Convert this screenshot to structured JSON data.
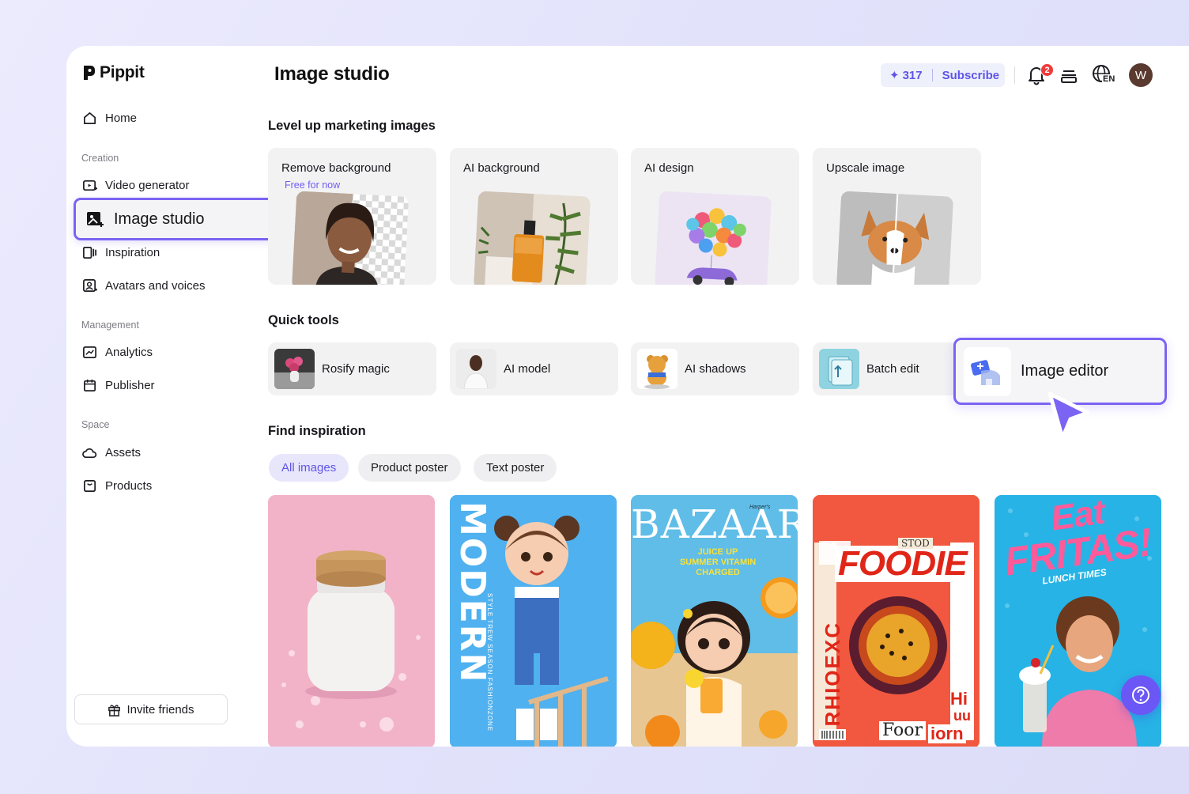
{
  "app": {
    "name": "Pippit"
  },
  "sidebar": {
    "home": "Home",
    "creation_label": "Creation",
    "items_creation": [
      "Video generator",
      "Image studio",
      "Inspiration",
      "Avatars and voices"
    ],
    "management_label": "Management",
    "items_management": [
      "Analytics",
      "Publisher"
    ],
    "space_label": "Space",
    "items_space": [
      "Assets",
      "Products"
    ],
    "invite": "Invite friends"
  },
  "header": {
    "title": "Image studio",
    "credits": "317",
    "subscribe": "Subscribe",
    "notification_count": "2",
    "language": "EN",
    "avatar_initial": "W"
  },
  "marketing": {
    "title": "Level up marketing images",
    "cards": [
      {
        "label": "Remove background",
        "sub": "Free for now"
      },
      {
        "label": "AI background"
      },
      {
        "label": "AI design"
      },
      {
        "label": "Upscale image"
      }
    ]
  },
  "quick_tools": {
    "title": "Quick tools",
    "items": [
      "Rosify magic",
      "AI model",
      "AI shadows",
      "Batch edit",
      "Image editor"
    ]
  },
  "inspiration": {
    "title": "Find inspiration",
    "filters": [
      "All images",
      "Product poster",
      "Text poster"
    ],
    "active_filter": "All images",
    "posters": [
      {
        "name": "pink-jar"
      },
      {
        "text": "MODERN",
        "sub": "STYLE TREW SEASON FASHIONZONE"
      },
      {
        "text": "BAZAAR",
        "sub": "JUICE UP SUMMER VITAMIN CHARGED",
        "tiny": "Harper's"
      },
      {
        "text": "FOODIE",
        "side": "RHIOEXC",
        "bottom": "Foor",
        "stack": "Hi",
        "stack2": "uu",
        "stack3": "iorn",
        "top": "STOD"
      },
      {
        "text": "Eat",
        "text2": "FRITAS!",
        "sub": "LUNCH TIMES"
      }
    ]
  },
  "colors": {
    "accent": "#6f5ef0",
    "highlight_border": "#7b63f3",
    "badge": "#f03a3a"
  }
}
